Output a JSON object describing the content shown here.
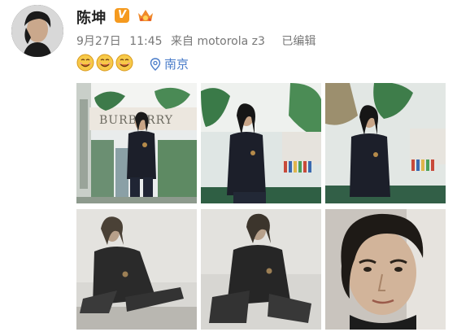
{
  "user": {
    "name": "陈坤",
    "verified_mark": "V"
  },
  "meta": {
    "date": "9月27日",
    "time": "11:45",
    "source": "来自 motorola z3",
    "edited": "已编辑"
  },
  "emojis": [
    "smiling-face-emoji",
    "smiling-face-emoji",
    "smiling-face-emoji"
  ],
  "location": {
    "name": "南京"
  },
  "photos": {
    "p1": {
      "sign_text": "BURBERRY"
    },
    "count": 6
  },
  "colors": {
    "name_text": "#222222",
    "meta_text": "#777777",
    "location_link": "#4a7cc9",
    "badge": "#f59a1f"
  }
}
